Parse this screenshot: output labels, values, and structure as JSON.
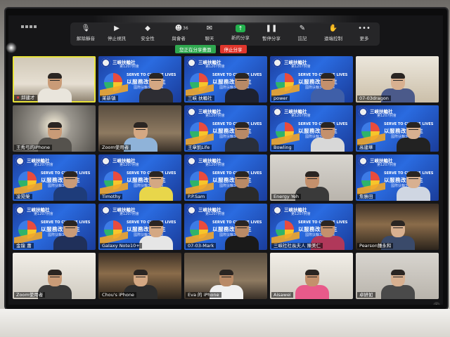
{
  "toolbar": {
    "items": [
      {
        "label": "解除靜音",
        "icon": "mic-muted-icon"
      },
      {
        "label": "停止視訊",
        "icon": "video-camera-icon"
      },
      {
        "label": "安全性",
        "icon": "shield-icon"
      },
      {
        "label": "與會者",
        "icon": "participants-icon",
        "count": "36"
      },
      {
        "label": "聊天",
        "icon": "chat-icon"
      },
      {
        "label": "新的分享",
        "icon": "share-screen-icon"
      },
      {
        "label": "暫停分享",
        "icon": "pause-icon"
      },
      {
        "label": "註記",
        "icon": "annotate-icon"
      },
      {
        "label": "遠端控制",
        "icon": "remote-control-icon"
      },
      {
        "label": "更多",
        "icon": "more-icon"
      }
    ],
    "sharing_status": "您正在分享畫面",
    "stop_share": "停止分享"
  },
  "tiles": [
    {
      "name": "邱建才",
      "bg": "room-a",
      "active": true,
      "muted": true,
      "shirt": "#e9e5dc"
    },
    {
      "name": "莱新镇",
      "bg": "vbg",
      "club": "三峡扶輪社",
      "sub": "第1207例會",
      "shirt": "#2d2d33"
    },
    {
      "name": "三峡 扶輪社",
      "bg": "vbg",
      "club": "三峽扶輪社",
      "sub": "第1207例會",
      "shirt": "#1e2230"
    },
    {
      "name": "power",
      "bg": "vbg",
      "club": "三峽扶輪社",
      "sub": "第1207例會",
      "shirt": "#3f5fa8"
    },
    {
      "name": "07-03dragon",
      "bg": "room-e",
      "shirt": "#4b5a8a"
    },
    {
      "name": "王秀弓的iPhone",
      "bg": "room-d",
      "shirt": "#55524d"
    },
    {
      "name": "Zoom使用者",
      "bg": "room-f",
      "shirt": "#8fb3d9"
    },
    {
      "name": "王章凱Life",
      "bg": "vbg",
      "club": "三峽扶輪社",
      "sub": "第1207例會",
      "shirt": "#2a2f3a"
    },
    {
      "name": "Bowling",
      "bg": "vbg",
      "club": "三峽扶輪社",
      "sub": "第1207例會",
      "shirt": "#d8d8d8"
    },
    {
      "name": "高建華",
      "bg": "vbg",
      "club": "三峽扶輪社",
      "sub": "第1207例會",
      "shirt": "#222"
    },
    {
      "name": "凌晃榮",
      "bg": "vbg",
      "club": "三峽扶輪社",
      "sub": "第1207例會",
      "shirt": "#1e3c7a"
    },
    {
      "name": "Timothy",
      "bg": "vbg",
      "club": "三峽扶輪社",
      "sub": "第1207例會",
      "shirt": "#e8d64a"
    },
    {
      "name": "P.P.Sam",
      "bg": "vbg",
      "club": "三峽扶輪社",
      "sub": "第1207例會",
      "shirt": "#2b2b2b"
    },
    {
      "name": "Energy Yeh",
      "bg": "room-c",
      "shirt": "#3a3a3a"
    },
    {
      "name": "詹勝田",
      "bg": "vbg",
      "club": "三峽扶輪社",
      "sub": "第1207例會",
      "shirt": "#cfd6e2"
    },
    {
      "name": "金龍 蕭",
      "bg": "vbg",
      "club": "三峽扶輪社",
      "sub": "第1207例會",
      "shirt": "#20305a"
    },
    {
      "name": "Galaxy Note10+",
      "bg": "vbg",
      "club": "三峽扶輪社",
      "sub": "第1207例會",
      "shirt": "#e6e6e6"
    },
    {
      "name": "07-03-Mark",
      "bg": "vbg",
      "club": "三峽扶輪社",
      "sub": "第1207例會",
      "shirt": "#1a1a1a"
    },
    {
      "name": "三峡社社長夫人 陳美仁",
      "bg": "vbg",
      "club": "三峽扶輪社",
      "sub": "第1207例會",
      "shirt": "#b0385a"
    },
    {
      "name": "Pearson鍾永和",
      "bg": "room-b",
      "shirt": "#3a4a6a"
    },
    {
      "name": "Zoom使用者",
      "bg": "room-g",
      "shirt": "#3a3a3a"
    },
    {
      "name": "Chou's iPhone",
      "bg": "room-b",
      "shirt": "#2d2d2d"
    },
    {
      "name": "Eva 的 iPhone",
      "bg": "room-f",
      "shirt": "#f0f0f0"
    },
    {
      "name": "Aisawei",
      "bg": "room-g",
      "shirt": "#e85a8a"
    },
    {
      "name": "卓妍如",
      "bg": "room-c",
      "shirt": "#4a4a4a"
    }
  ],
  "vbg_text": {
    "slogan": "SERVE TO CHANGE LIVES",
    "cn": "以服務改善人生",
    "tiny": "國際扶輪3490地區"
  }
}
